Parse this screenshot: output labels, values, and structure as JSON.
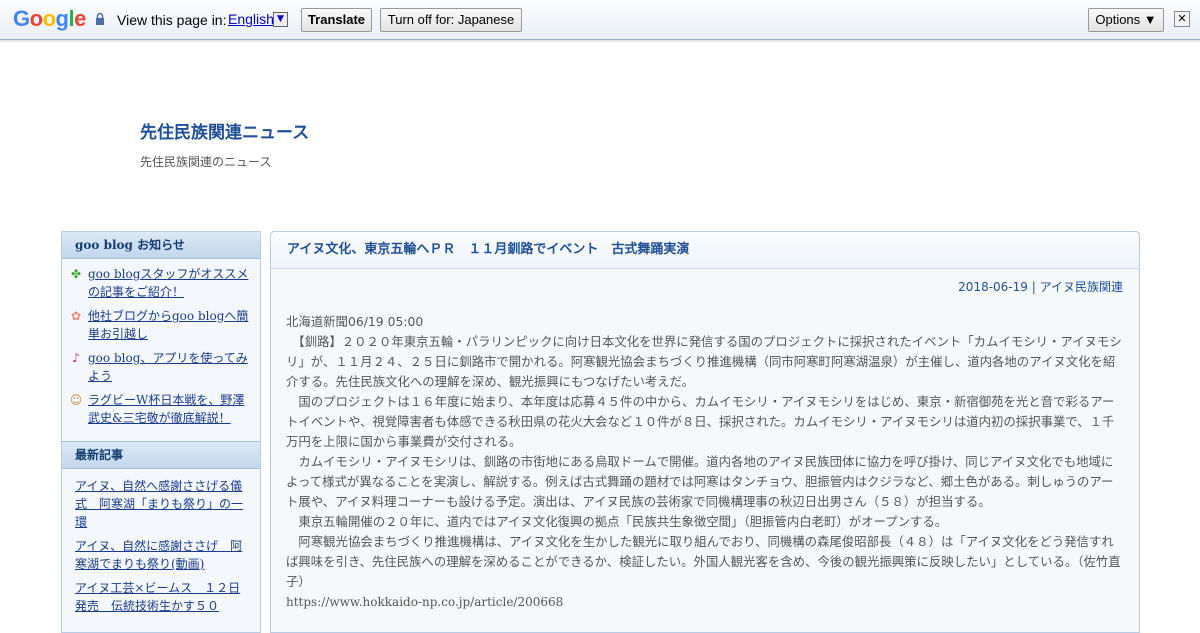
{
  "translate_bar": {
    "logo_letters": [
      {
        "ch": "G",
        "color": "#4285f4"
      },
      {
        "ch": "o",
        "color": "#ea4335"
      },
      {
        "ch": "o",
        "color": "#fbbc05"
      },
      {
        "ch": "g",
        "color": "#4285f4"
      },
      {
        "ch": "l",
        "color": "#34a853"
      },
      {
        "ch": "e",
        "color": "#ea4335"
      }
    ],
    "view_label": "View this page in:",
    "language": "English",
    "translate_button": "Translate",
    "turn_off_button": "Turn off for: Japanese",
    "options_button": "Options ▼",
    "close_glyph": "✕"
  },
  "blog": {
    "title": "先住民族関連ニュース",
    "description": "先住民族関連のニュース"
  },
  "sidebar": {
    "notice_header": "goo blog お知らせ",
    "notices": [
      {
        "icon": "clover-icon",
        "glyph": "✤",
        "color": "#3aa63a",
        "label": "goo blogスタッフがオススメの記事をご紹介！"
      },
      {
        "icon": "flower-icon",
        "glyph": "✿",
        "color": "#e8877a",
        "label": "他社ブログからgoo blogへ簡単お引越し"
      },
      {
        "icon": "music-note-icon",
        "glyph": "♪",
        "color": "#c0307a",
        "label": "goo blog、アプリを使ってみよう"
      },
      {
        "icon": "character-icon",
        "glyph": "☺",
        "color": "#c08a40",
        "label": "ラグビーW杯日本戦を、野澤武史&三宅敬が徹底解説！"
      }
    ],
    "recent_header": "最新記事",
    "recent": [
      "アイヌ、自然へ感謝ささげる儀式　阿寒湖「まりも祭り」の一環",
      "アイヌ、自然に感謝ささげ　阿寒湖でまりも祭り(動画)",
      "アイヌ工芸×ビームス　１２日発売　伝統技術生かす５０"
    ]
  },
  "article": {
    "title": "アイヌ文化、東京五輪へＰＲ　１１月釧路でイベント　古式舞踊実演",
    "date": "2018-06-19",
    "separator": " | ",
    "category": "アイヌ民族関連",
    "source_line": "北海道新聞06/19 05:00",
    "paragraphs": [
      "　【釧路】２０２０年東京五輪・パラリンピックに向け日本文化を世界に発信する国のプロジェクトに採択されたイベント「カムイモシリ・アイヌモシリ」が、１１月２４、２５日に釧路市で開かれる。阿寒観光協会まちづくり推進機構（同市阿寒町阿寒湖温泉）が主催し、道内各地のアイヌ文化を紹介する。先住民族文化への理解を深め、観光振興にもつなげたい考えだ。",
      "　国のプロジェクトは１６年度に始まり、本年度は応募４５件の中から、カムイモシリ・アイヌモシリをはじめ、東京・新宿御苑を光と音で彩るアートイベントや、視覚障害者も体感できる秋田県の花火大会など１０件が８日、採択された。カムイモシリ・アイヌモシリは道内初の採択事業で、１千万円を上限に国から事業費が交付される。",
      "　カムイモシリ・アイヌモシリは、釧路の市街地にある鳥取ドームで開催。道内各地のアイヌ民族団体に協力を呼び掛け、同じアイヌ文化でも地域によって様式が異なることを実演し、解説する。例えば古式舞踊の題材では阿寒はタンチョウ、胆振管内はクジラなど、郷土色がある。刺しゅうのアート展や、アイヌ料理コーナーも設ける予定。演出は、アイヌ民族の芸術家で同機構理事の秋辺日出男さん（５８）が担当する。",
      "　東京五輪開催の２０年に、道内ではアイヌ文化復興の拠点「民族共生象徴空間」（胆振管内白老町）がオープンする。",
      "　阿寒観光協会まちづくり推進機構は、アイヌ文化を生かした観光に取り組んでおり、同機構の森尾俊昭部長（４８）は「アイヌ文化をどう発信すれば興味を引き、先住民族への理解を深めることができるか、検証したい。外国人観光客を含め、今後の観光振興策に反映したい」としている。（佐竹直子）"
    ],
    "url": "https://www.hokkaido-np.co.jp/article/200668"
  }
}
